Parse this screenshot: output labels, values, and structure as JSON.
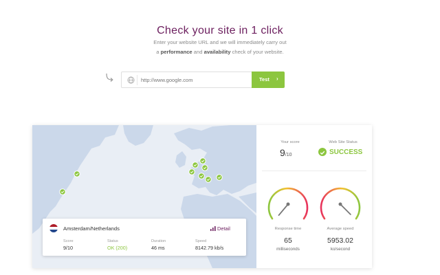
{
  "hero": {
    "title": "Check your site in 1 click",
    "subtitle_line1": "Enter your website URL and we will immediately carry out",
    "subtitle_pre": "a",
    "subtitle_bold1": "performance",
    "subtitle_mid": "and",
    "subtitle_bold2": "availability",
    "subtitle_post": "check of your website."
  },
  "search": {
    "placeholder": "http://www.google.com",
    "value": "",
    "button_label": "Test",
    "button_chevron": "›"
  },
  "location_card": {
    "name": "Amsterdam/Netherlands",
    "detail_label": "Detail",
    "flag_colors": [
      "#ae1c28",
      "#ffffff",
      "#21468b"
    ],
    "columns": [
      {
        "label": "Score",
        "value": "9/10"
      },
      {
        "label": "Status",
        "value": "OK (200)"
      },
      {
        "label": "Duration",
        "value": "46 ms"
      },
      {
        "label": "Speed",
        "value": "8142.79 kb/s"
      }
    ]
  },
  "summary": {
    "score_label": "Your score",
    "score_value": "9",
    "score_max": "/10",
    "status_label": "Web Site Status",
    "status_value": "SUCCESS"
  },
  "gauges": [
    {
      "label": "Response time",
      "value": "65",
      "unit": "milliseconds"
    },
    {
      "label": "Average speed",
      "value": "5953.02",
      "unit": "ko/second"
    }
  ],
  "colors": {
    "accent_purple": "#6b1d5d",
    "success_green": "#8cc63f",
    "map_water": "#e9eef5",
    "map_land": "#cbd8ea"
  },
  "map_markers": {
    "count": 9,
    "icon": "check-icon"
  }
}
